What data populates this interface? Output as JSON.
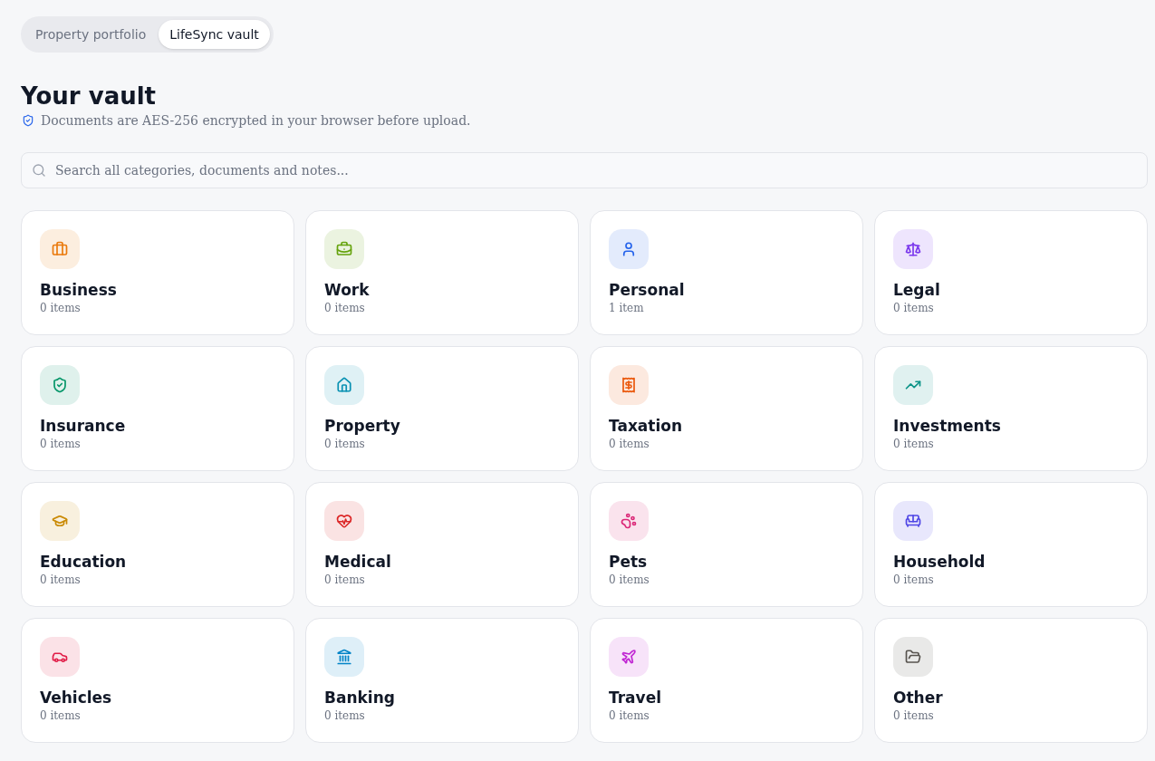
{
  "tabs": [
    {
      "label": "Property portfolio",
      "selected": false
    },
    {
      "label": "LifeSync vault",
      "selected": true
    }
  ],
  "header": {
    "title": "Your vault",
    "subtitle": "Documents are AES-256 encrypted in your browser before upload."
  },
  "search": {
    "placeholder": "Search all categories, documents and notes..."
  },
  "categories": [
    {
      "name": "Business",
      "count": "0 items",
      "color": "#ea7a0c"
    },
    {
      "name": "Work",
      "count": "0 items",
      "color": "#65a30d"
    },
    {
      "name": "Personal",
      "count": "1 item",
      "color": "#2563eb"
    },
    {
      "name": "Legal",
      "count": "0 items",
      "color": "#7c3aed"
    },
    {
      "name": "Insurance",
      "count": "0 items",
      "color": "#059669"
    },
    {
      "name": "Property",
      "count": "0 items",
      "color": "#0891b2"
    },
    {
      "name": "Taxation",
      "count": "0 items",
      "color": "#ea580c"
    },
    {
      "name": "Investments",
      "count": "0 items",
      "color": "#0d9488"
    },
    {
      "name": "Education",
      "count": "0 items",
      "color": "#ca8a04"
    },
    {
      "name": "Medical",
      "count": "0 items",
      "color": "#dc2626"
    },
    {
      "name": "Pets",
      "count": "0 items",
      "color": "#db2777"
    },
    {
      "name": "Household",
      "count": "0 items",
      "color": "#4f46e5"
    },
    {
      "name": "Vehicles",
      "count": "0 items",
      "color": "#e11d48"
    },
    {
      "name": "Banking",
      "count": "0 items",
      "color": "#0284c7"
    },
    {
      "name": "Travel",
      "count": "0 items",
      "color": "#c026d3"
    },
    {
      "name": "Other",
      "count": "0 items",
      "color": "#57534e"
    }
  ]
}
